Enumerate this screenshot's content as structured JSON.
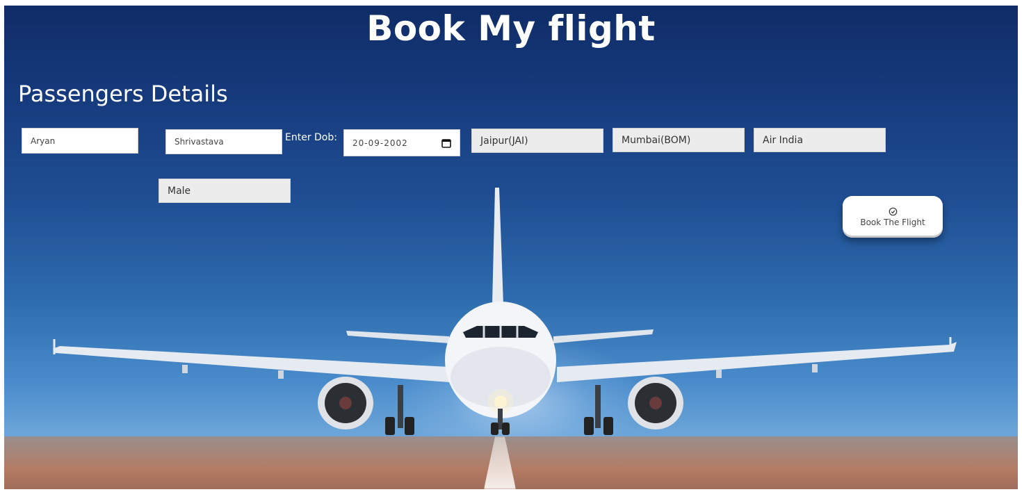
{
  "header": {
    "title": "Book My flight"
  },
  "section": {
    "title": "Passengers Details"
  },
  "form": {
    "first_name": "Aryan",
    "last_name": "Shrivastava",
    "dob_label": "Enter Dob:",
    "dob_value": "20-09-2002",
    "from_city": "Jaipur(JAI)",
    "to_city": "Mumbai(BOM)",
    "airline": "Air India",
    "gender": "Male"
  },
  "actions": {
    "book_label": "Book The Flight",
    "book_icon": "check-circle-icon"
  },
  "background": {
    "description_icon": "airplane-photo",
    "sky_color": "#1f4e93",
    "runway_color": "#a88476"
  }
}
